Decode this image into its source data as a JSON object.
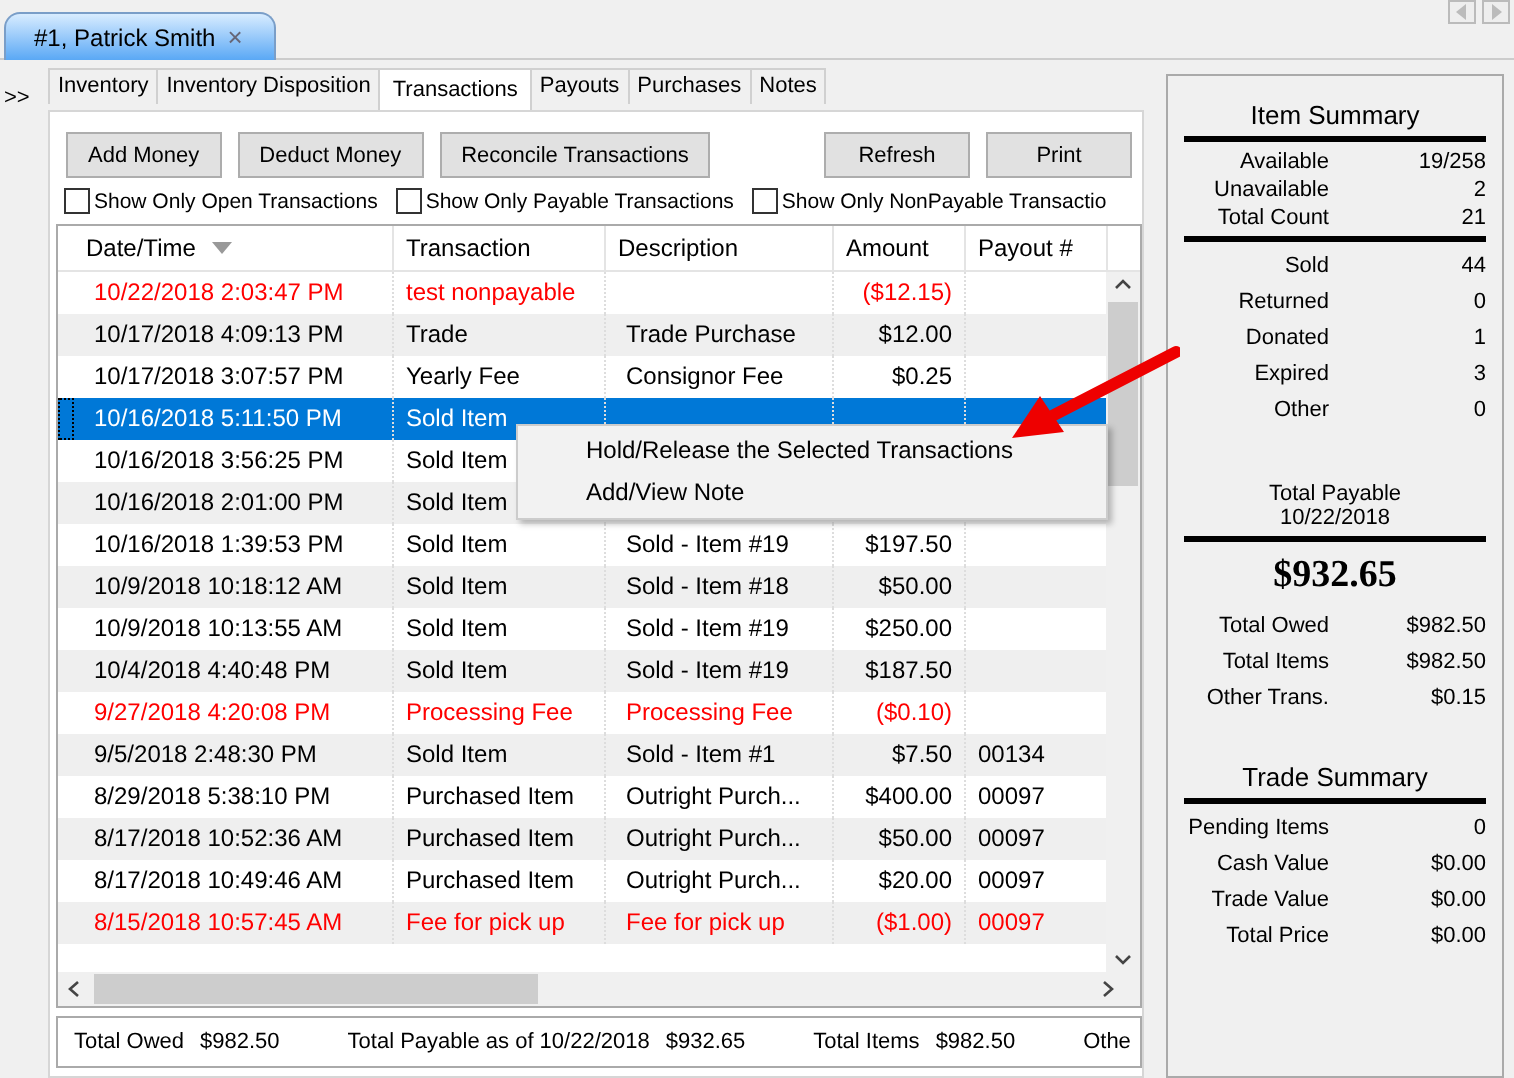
{
  "doc_tab": {
    "label": "#1, Patrick Smith",
    "close": "×"
  },
  "expander": ">>",
  "tabs": [
    {
      "label": "Inventory",
      "selected": false
    },
    {
      "label": "Inventory Disposition",
      "selected": false
    },
    {
      "label": "Transactions",
      "selected": true
    },
    {
      "label": "Payouts",
      "selected": false
    },
    {
      "label": "Purchases",
      "selected": false
    },
    {
      "label": "Notes",
      "selected": false
    }
  ],
  "buttons_left": [
    "Add Money",
    "Deduct Money",
    "Reconcile Transactions"
  ],
  "buttons_right": [
    "Refresh",
    "Print"
  ],
  "filters": [
    {
      "label": "Show Only Open Transactions",
      "checked": false
    },
    {
      "label": "Show Only Payable Transactions",
      "checked": false
    },
    {
      "label": "Show Only NonPayable Transactio",
      "checked": false
    }
  ],
  "table": {
    "columns": [
      "Date/Time",
      "Transaction",
      "Description",
      "Amount",
      "Payout #"
    ],
    "rows": [
      {
        "cells": [
          "10/22/2018 2:03:47 PM",
          "test nonpayable",
          "",
          "($12.15)",
          ""
        ],
        "negative": true,
        "selected": false
      },
      {
        "cells": [
          "10/17/2018 4:09:13 PM",
          "Trade",
          "Trade Purchase",
          "$12.00",
          ""
        ],
        "negative": false,
        "selected": false
      },
      {
        "cells": [
          "10/17/2018 3:07:57 PM",
          "Yearly Fee",
          "Consignor Fee",
          "$0.25",
          ""
        ],
        "negative": false,
        "selected": false
      },
      {
        "cells": [
          "10/16/2018 5:11:50 PM",
          "Sold Item",
          "",
          "",
          ""
        ],
        "negative": false,
        "selected": true
      },
      {
        "cells": [
          "10/16/2018 3:56:25 PM",
          "Sold Item",
          "",
          "",
          ""
        ],
        "negative": false,
        "selected": false
      },
      {
        "cells": [
          "10/16/2018 2:01:00 PM",
          "Sold Item",
          "",
          "",
          ""
        ],
        "negative": false,
        "selected": false
      },
      {
        "cells": [
          "10/16/2018 1:39:53 PM",
          "Sold Item",
          "Sold - Item #19",
          "$197.50",
          ""
        ],
        "negative": false,
        "selected": false
      },
      {
        "cells": [
          "10/9/2018 10:18:12 AM",
          "Sold Item",
          "Sold - Item #18",
          "$50.00",
          ""
        ],
        "negative": false,
        "selected": false
      },
      {
        "cells": [
          "10/9/2018 10:13:55 AM",
          "Sold Item",
          "Sold - Item #19",
          "$250.00",
          ""
        ],
        "negative": false,
        "selected": false
      },
      {
        "cells": [
          "10/4/2018 4:40:48 PM",
          "Sold Item",
          "Sold - Item #19",
          "$187.50",
          ""
        ],
        "negative": false,
        "selected": false
      },
      {
        "cells": [
          "9/27/2018 4:20:08 PM",
          "Processing Fee",
          "Processing Fee",
          "($0.10)",
          ""
        ],
        "negative": true,
        "selected": false
      },
      {
        "cells": [
          "9/5/2018 2:48:30 PM",
          "Sold Item",
          "Sold - Item #1",
          "$7.50",
          "00134"
        ],
        "negative": false,
        "selected": false
      },
      {
        "cells": [
          "8/29/2018 5:38:10 PM",
          "Purchased Item",
          "Outright Purch...",
          "$400.00",
          "00097"
        ],
        "negative": false,
        "selected": false
      },
      {
        "cells": [
          "8/17/2018 10:52:36 AM",
          "Purchased Item",
          "Outright Purch...",
          "$50.00",
          "00097"
        ],
        "negative": false,
        "selected": false
      },
      {
        "cells": [
          "8/17/2018 10:49:46 AM",
          "Purchased Item",
          "Outright Purch...",
          "$20.00",
          "00097"
        ],
        "negative": false,
        "selected": false
      },
      {
        "cells": [
          "8/15/2018 10:57:45 AM",
          "Fee for pick up",
          "Fee for pick up",
          "($1.00)",
          "00097"
        ],
        "negative": true,
        "selected": false
      }
    ]
  },
  "context_menu": [
    "Hold/Release the Selected Transactions",
    "Add/View Note"
  ],
  "footer": [
    {
      "label": "Total Owed",
      "value": "$982.50"
    },
    {
      "label": "Total Payable as of 10/22/2018",
      "value": "$932.65"
    },
    {
      "label": "Total Items",
      "value": "$982.50"
    },
    {
      "label": "Othe"
    }
  ],
  "item_summary": {
    "title": "Item Summary",
    "counts": [
      {
        "label": "Available",
        "value": "19/258"
      },
      {
        "label": "Unavailable",
        "value": "2"
      },
      {
        "label": "Total Count",
        "value": "21"
      }
    ],
    "dispositions": [
      {
        "label": "Sold",
        "value": "44"
      },
      {
        "label": "Returned",
        "value": "0"
      },
      {
        "label": "Donated",
        "value": "1"
      },
      {
        "label": "Expired",
        "value": "3"
      },
      {
        "label": "Other",
        "value": "0"
      }
    ],
    "payable_label": "Total Payable",
    "payable_date": "10/22/2018",
    "payable_amount": "$932.65",
    "totals": [
      {
        "label": "Total Owed",
        "value": "$982.50"
      },
      {
        "label": "Total Items",
        "value": "$982.50"
      },
      {
        "label": "Other Trans.",
        "value": "$0.15"
      }
    ]
  },
  "trade_summary": {
    "title": "Trade Summary",
    "rows": [
      {
        "label": "Pending Items",
        "value": "0"
      },
      {
        "label": "Cash Value",
        "value": "$0.00"
      },
      {
        "label": "Trade Value",
        "value": "$0.00"
      },
      {
        "label": "Total Price",
        "value": "$0.00"
      }
    ]
  }
}
